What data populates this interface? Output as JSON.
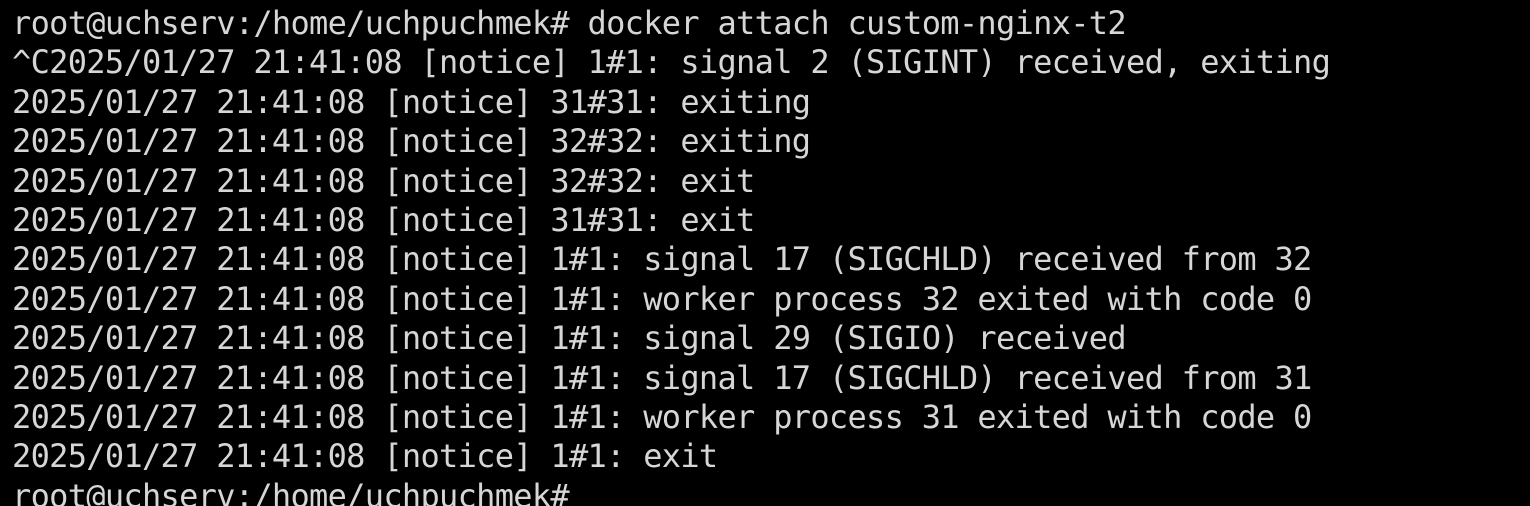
{
  "terminal": {
    "lines": [
      "root@uchserv:/home/uchpuchmek# docker attach custom-nginx-t2",
      "^C2025/01/27 21:41:08 [notice] 1#1: signal 2 (SIGINT) received, exiting",
      "2025/01/27 21:41:08 [notice] 31#31: exiting",
      "2025/01/27 21:41:08 [notice] 32#32: exiting",
      "2025/01/27 21:41:08 [notice] 32#32: exit",
      "2025/01/27 21:41:08 [notice] 31#31: exit",
      "2025/01/27 21:41:08 [notice] 1#1: signal 17 (SIGCHLD) received from 32",
      "2025/01/27 21:41:08 [notice] 1#1: worker process 32 exited with code 0",
      "2025/01/27 21:41:08 [notice] 1#1: signal 29 (SIGIO) received",
      "2025/01/27 21:41:08 [notice] 1#1: signal 17 (SIGCHLD) received from 31",
      "2025/01/27 21:41:08 [notice] 1#1: worker process 31 exited with code 0",
      "2025/01/27 21:41:08 [notice] 1#1: exit"
    ],
    "prompt": "root@uchserv:/home/uchpuchmek#",
    "colors": {
      "background": "#000000",
      "foreground": "#d6d6d6"
    }
  }
}
